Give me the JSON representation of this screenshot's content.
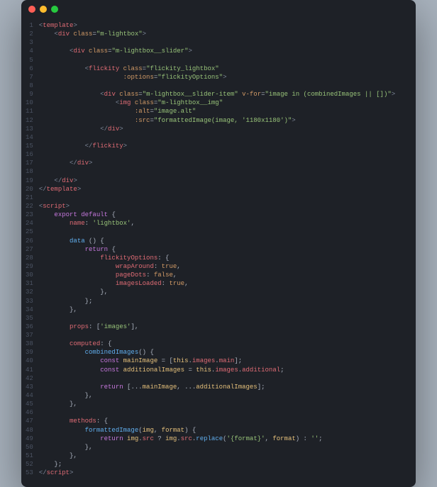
{
  "window": {
    "traffic_lights": [
      "close",
      "minimize",
      "zoom"
    ]
  },
  "lines": [
    {
      "n": 1,
      "html": "<span class='br'>&lt;</span><span class='tg'>template</span><span class='br'>&gt;</span>"
    },
    {
      "n": 2,
      "html": "    <span class='br'>&lt;</span><span class='tg'>div</span> <span class='at'>class</span><span class='p'>=</span><span class='st'>\"m-lightbox\"</span><span class='br'>&gt;</span>"
    },
    {
      "n": 3,
      "html": ""
    },
    {
      "n": 4,
      "html": "        <span class='br'>&lt;</span><span class='tg'>div</span> <span class='at'>class</span><span class='p'>=</span><span class='st'>\"m-lightbox__slider\"</span><span class='br'>&gt;</span>"
    },
    {
      "n": 5,
      "html": ""
    },
    {
      "n": 6,
      "html": "            <span class='br'>&lt;</span><span class='tg'>flickity</span> <span class='at'>class</span><span class='p'>=</span><span class='st'>\"flickity_lightbox\"</span>"
    },
    {
      "n": 7,
      "html": "                      <span class='at'>:options</span><span class='p'>=</span><span class='st'>\"flickityOptions\"</span><span class='br'>&gt;</span>"
    },
    {
      "n": 8,
      "html": ""
    },
    {
      "n": 9,
      "html": "                <span class='br'>&lt;</span><span class='tg'>div</span> <span class='at'>class</span><span class='p'>=</span><span class='st'>\"m-lightbox__slider-item\"</span> <span class='at'>v-for</span><span class='p'>=</span><span class='st'>\"image in (combinedImages || [])\"</span><span class='br'>&gt;</span>"
    },
    {
      "n": 10,
      "html": "                    <span class='br'>&lt;</span><span class='tg'>img</span> <span class='at'>class</span><span class='p'>=</span><span class='st'>\"m-lightbox__img\"</span>"
    },
    {
      "n": 11,
      "html": "                         <span class='at'>:alt</span><span class='p'>=</span><span class='st'>\"image.alt\"</span>"
    },
    {
      "n": 12,
      "html": "                         <span class='at'>:src</span><span class='p'>=</span><span class='st'>\"formattedImage(image, '1180x1180')\"</span><span class='br'>&gt;</span>"
    },
    {
      "n": 13,
      "html": "                <span class='br'>&lt;/</span><span class='tg'>div</span><span class='br'>&gt;</span>"
    },
    {
      "n": 14,
      "html": ""
    },
    {
      "n": 15,
      "html": "            <span class='br'>&lt;/</span><span class='tg'>flickity</span><span class='br'>&gt;</span>"
    },
    {
      "n": 16,
      "html": ""
    },
    {
      "n": 17,
      "html": "        <span class='br'>&lt;/</span><span class='tg'>div</span><span class='br'>&gt;</span>"
    },
    {
      "n": 18,
      "html": ""
    },
    {
      "n": 19,
      "html": "    <span class='br'>&lt;/</span><span class='tg'>div</span><span class='br'>&gt;</span>"
    },
    {
      "n": 20,
      "html": "<span class='br'>&lt;/</span><span class='tg'>template</span><span class='br'>&gt;</span>"
    },
    {
      "n": 21,
      "html": ""
    },
    {
      "n": 22,
      "html": "<span class='br'>&lt;</span><span class='tg'>script</span><span class='br'>&gt;</span>"
    },
    {
      "n": 23,
      "html": "    <span class='kw'>export</span> <span class='kw'>default</span> <span class='p'>{</span>"
    },
    {
      "n": 24,
      "html": "        <span class='pr'>name</span><span class='p'>:</span> <span class='st'>'lightbox'</span><span class='p'>,</span>"
    },
    {
      "n": 25,
      "html": ""
    },
    {
      "n": 26,
      "html": "        <span class='fn'>data</span> <span class='p'>() {</span>"
    },
    {
      "n": 27,
      "html": "            <span class='kw'>return</span> <span class='p'>{</span>"
    },
    {
      "n": 28,
      "html": "                <span class='pr'>flickityOptions</span><span class='p'>: {</span>"
    },
    {
      "n": 29,
      "html": "                    <span class='pr'>wrapAround</span><span class='p'>:</span> <span class='bo'>true</span><span class='p'>,</span>"
    },
    {
      "n": 30,
      "html": "                    <span class='pr'>pageDots</span><span class='p'>:</span> <span class='bo'>false</span><span class='p'>,</span>"
    },
    {
      "n": 31,
      "html": "                    <span class='pr'>imagesLoaded</span><span class='p'>:</span> <span class='bo'>true</span><span class='p'>,</span>"
    },
    {
      "n": 32,
      "html": "                <span class='p'>},</span>"
    },
    {
      "n": 33,
      "html": "            <span class='p'>};</span>"
    },
    {
      "n": 34,
      "html": "        <span class='p'>},</span>"
    },
    {
      "n": 35,
      "html": ""
    },
    {
      "n": 36,
      "html": "        <span class='pr'>props</span><span class='p'>: [</span><span class='st'>'images'</span><span class='p'>],</span>"
    },
    {
      "n": 37,
      "html": ""
    },
    {
      "n": 38,
      "html": "        <span class='pr'>computed</span><span class='p'>: {</span>"
    },
    {
      "n": 39,
      "html": "            <span class='fn'>combinedImages</span><span class='p'>() {</span>"
    },
    {
      "n": 40,
      "html": "                <span class='kw'>const</span> <span class='va'>mainImage</span> <span class='p'>= [</span><span class='th'>this</span><span class='p'>.</span><span class='pr'>images</span><span class='p'>.</span><span class='pr'>main</span><span class='p'>];</span>"
    },
    {
      "n": 41,
      "html": "                <span class='kw'>const</span> <span class='va'>additionalImages</span> <span class='p'>=</span> <span class='th'>this</span><span class='p'>.</span><span class='pr'>images</span><span class='p'>.</span><span class='pr'>additional</span><span class='p'>;</span>"
    },
    {
      "n": 42,
      "html": ""
    },
    {
      "n": 43,
      "html": "                <span class='kw'>return</span> <span class='p'>[...</span><span class='va'>mainImage</span><span class='p'>, ...</span><span class='va'>additionalImages</span><span class='p'>];</span>"
    },
    {
      "n": 44,
      "html": "            <span class='p'>},</span>"
    },
    {
      "n": 45,
      "html": "        <span class='p'>},</span>"
    },
    {
      "n": 46,
      "html": ""
    },
    {
      "n": 47,
      "html": "        <span class='pr'>methods</span><span class='p'>: {</span>"
    },
    {
      "n": 48,
      "html": "            <span class='fn'>formattedImage</span><span class='p'>(</span><span class='va'>img</span><span class='p'>,</span> <span class='va'>format</span><span class='p'>) {</span>"
    },
    {
      "n": 49,
      "html": "                <span class='kw'>return</span> <span class='va'>img</span><span class='p'>.</span><span class='pr'>src</span> <span class='p'>?</span> <span class='va'>img</span><span class='p'>.</span><span class='pr'>src</span><span class='p'>.</span><span class='fn'>replace</span><span class='p'>(</span><span class='st'>'{format}'</span><span class='p'>,</span> <span class='va'>format</span><span class='p'>) :</span> <span class='st'>''</span><span class='p'>;</span>"
    },
    {
      "n": 50,
      "html": "            <span class='p'>},</span>"
    },
    {
      "n": 51,
      "html": "        <span class='p'>},</span>"
    },
    {
      "n": 52,
      "html": "    <span class='p'>};</span>"
    },
    {
      "n": 53,
      "html": "<span class='br'>&lt;/</span><span class='tg'>script</span><span class='br'>&gt;</span>"
    }
  ]
}
